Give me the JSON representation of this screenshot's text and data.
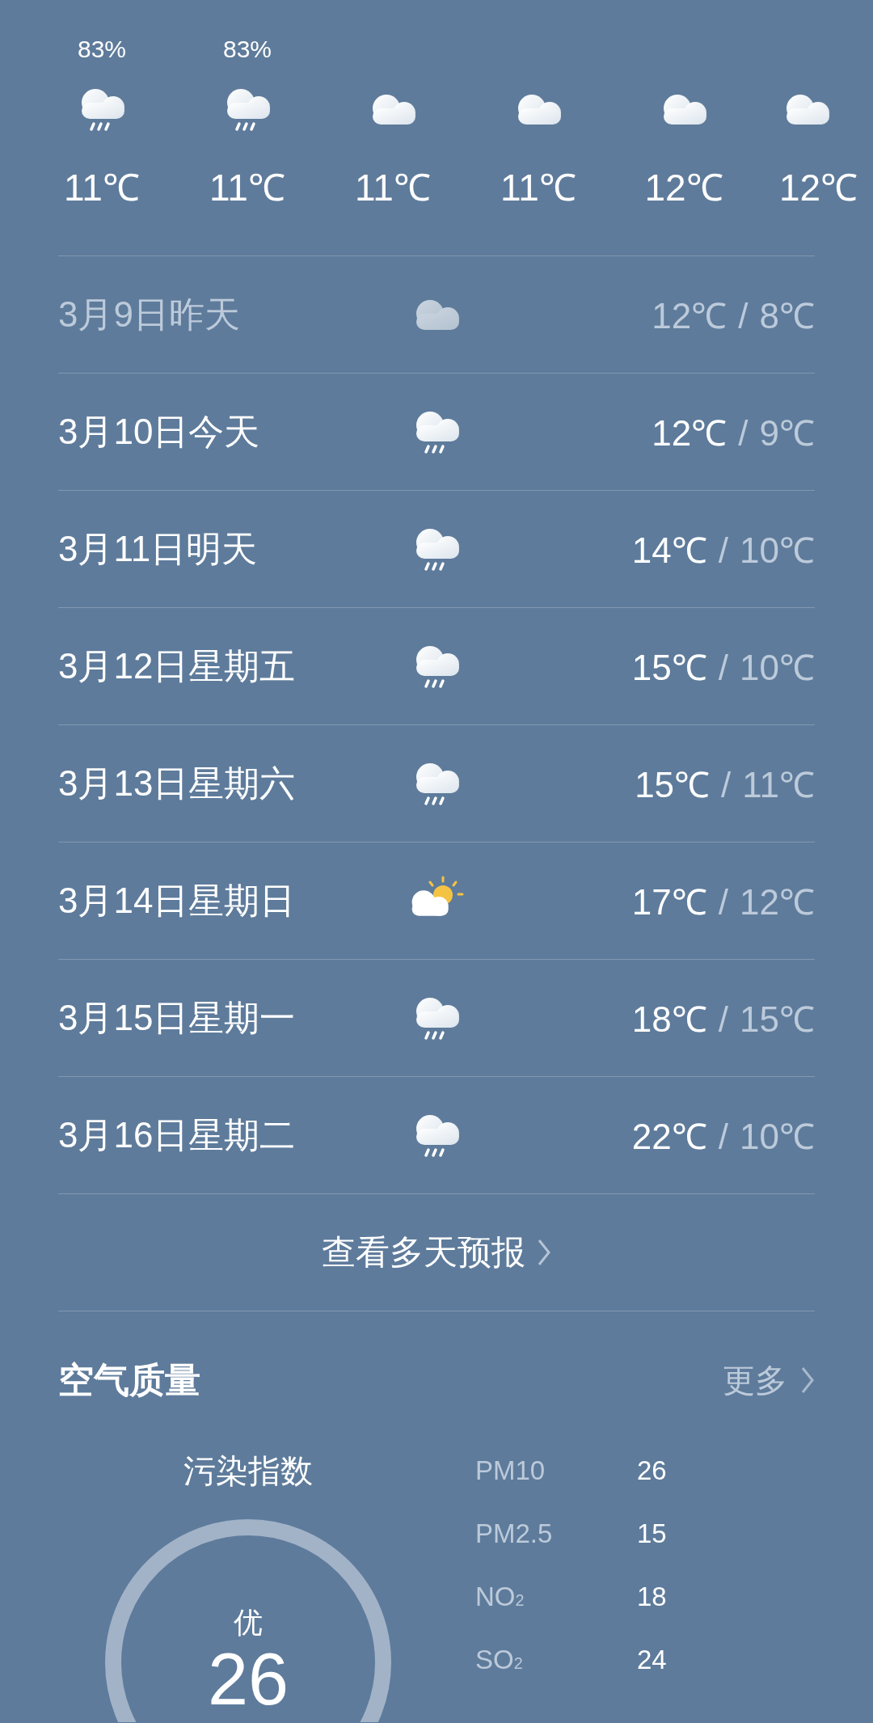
{
  "hourly": [
    {
      "humidity": "83%",
      "kind": "rain",
      "temp": "11℃"
    },
    {
      "humidity": "83%",
      "kind": "rain",
      "temp": "11℃"
    },
    {
      "kind": "cloudy",
      "temp": "11℃"
    },
    {
      "kind": "cloudy",
      "temp": "11℃"
    },
    {
      "kind": "cloudy",
      "temp": "12℃"
    },
    {
      "kind": "cloudy",
      "temp": "12℃"
    }
  ],
  "daily": [
    {
      "date": "3月9日昨天",
      "kind": "cloudy",
      "high": "12℃",
      "low": "8℃",
      "past": true
    },
    {
      "date": "3月10日今天",
      "kind": "rain",
      "high": "12℃",
      "low": "9℃",
      "past": false
    },
    {
      "date": "3月11日明天",
      "kind": "rain",
      "high": "14℃",
      "low": "10℃",
      "past": false
    },
    {
      "date": "3月12日星期五",
      "kind": "rain",
      "high": "15℃",
      "low": "10℃",
      "past": false
    },
    {
      "date": "3月13日星期六",
      "kind": "rain",
      "high": "15℃",
      "low": "11℃",
      "past": false
    },
    {
      "date": "3月14日星期日",
      "kind": "partly_sunny",
      "high": "17℃",
      "low": "12℃",
      "past": false
    },
    {
      "date": "3月15日星期一",
      "kind": "rain",
      "high": "18℃",
      "low": "15℃",
      "past": false
    },
    {
      "date": "3月16日星期二",
      "kind": "rain",
      "high": "22℃",
      "low": "10℃",
      "past": false
    }
  ],
  "separator": "/",
  "more_forecast": "查看多天预报",
  "air_quality": {
    "title": "空气质量",
    "more": "更多",
    "index_label": "污染指数",
    "grade": "优",
    "aqi": "26",
    "pollutants": [
      {
        "name": "PM10",
        "value": "26"
      },
      {
        "name": "PM2.5",
        "value": "15"
      },
      {
        "name": "NO$_{2}$",
        "value": "18"
      },
      {
        "name": "SO$_{2}$",
        "value": "24"
      }
    ]
  }
}
